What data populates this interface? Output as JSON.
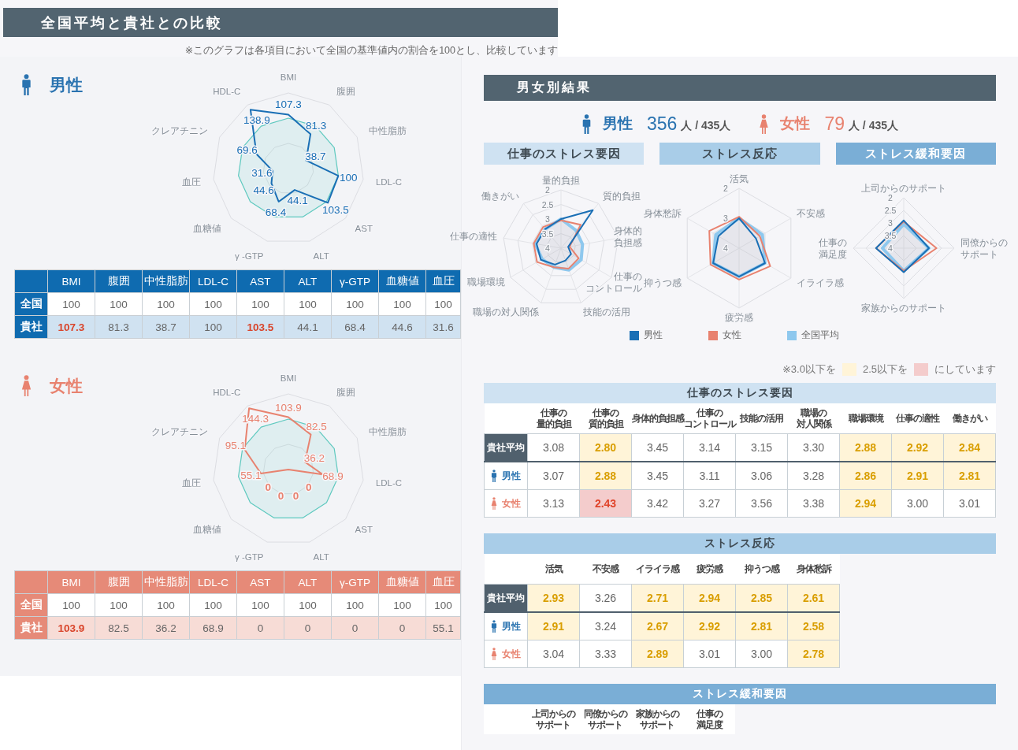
{
  "header": {
    "title": "全国平均と貴社との比較",
    "note": "※このグラフは各項目において全国の基準値内の割合を100とし、比較しています"
  },
  "comparison": [
    {
      "kind": "male",
      "title": "男性",
      "radar": {
        "axes": [
          [
            "BMI"
          ],
          [
            "HDL-C"
          ],
          [
            "腹囲"
          ],
          [
            "クレアチニン"
          ],
          [
            "中性脂肪"
          ],
          [
            "血圧"
          ],
          [
            "LDL-C"
          ],
          [
            "血糖値"
          ],
          [
            "AST"
          ],
          [
            "γ -GTP"
          ],
          [
            "ALT"
          ]
        ],
        "value_labels": [
          "107.3",
          "138.9",
          "81.3",
          "69.6",
          "38.7",
          "31.6",
          "100",
          "44.6",
          "44.1",
          "103.5",
          "68.4"
        ]
      },
      "table": {
        "columns": [
          "BMI",
          "腹囲",
          "中性脂肪",
          "LDL-C",
          "AST",
          "ALT",
          "γ-GTP",
          "血糖値",
          "血圧"
        ],
        "rows": [
          {
            "label": "全国",
            "kind": "national",
            "values": [
              {
                "text": "100",
                "high": false
              },
              {
                "text": "100",
                "high": false
              },
              {
                "text": "100",
                "high": false
              },
              {
                "text": "100",
                "high": false
              },
              {
                "text": "100",
                "high": false
              },
              {
                "text": "100",
                "high": false
              },
              {
                "text": "100",
                "high": false
              },
              {
                "text": "100",
                "high": false
              },
              {
                "text": "100",
                "high": false
              }
            ]
          },
          {
            "label": "貴社",
            "kind": "company",
            "values": [
              {
                "text": "107.3",
                "high": true
              },
              {
                "text": "81.3",
                "high": false
              },
              {
                "text": "38.7",
                "high": false
              },
              {
                "text": "100",
                "high": false
              },
              {
                "text": "103.5",
                "high": true
              },
              {
                "text": "44.1",
                "high": false
              },
              {
                "text": "68.4",
                "high": false
              },
              {
                "text": "44.6",
                "high": false
              },
              {
                "text": "31.6",
                "high": false
              }
            ]
          }
        ]
      }
    },
    {
      "kind": "female",
      "title": "女性",
      "radar": {
        "axes": [
          [
            "BMI"
          ],
          [
            "HDL-C"
          ],
          [
            "腹囲"
          ],
          [
            "クレアチニン"
          ],
          [
            "中性脂肪"
          ],
          [
            "血圧"
          ],
          [
            "LDL-C"
          ],
          [
            "血糖値"
          ],
          [
            "AST"
          ],
          [
            "γ -GTP"
          ],
          [
            "ALT"
          ]
        ],
        "value_labels": [
          "103.9",
          "144.3",
          "82.5",
          "95.1",
          "36.2",
          "55.1",
          "68.9",
          "0",
          "0",
          "0",
          "0"
        ]
      },
      "table": {
        "columns": [
          "BMI",
          "腹囲",
          "中性脂肪",
          "LDL-C",
          "AST",
          "ALT",
          "γ-GTP",
          "血糖値",
          "血圧"
        ],
        "rows": [
          {
            "label": "全国",
            "kind": "national",
            "values": [
              {
                "text": "100",
                "high": false
              },
              {
                "text": "100",
                "high": false
              },
              {
                "text": "100",
                "high": false
              },
              {
                "text": "100",
                "high": false
              },
              {
                "text": "100",
                "high": false
              },
              {
                "text": "100",
                "high": false
              },
              {
                "text": "100",
                "high": false
              },
              {
                "text": "100",
                "high": false
              },
              {
                "text": "100",
                "high": false
              }
            ]
          },
          {
            "label": "貴社",
            "kind": "company",
            "values": [
              {
                "text": "103.9",
                "high": true
              },
              {
                "text": "82.5",
                "high": false
              },
              {
                "text": "36.2",
                "high": false
              },
              {
                "text": "68.9",
                "high": false
              },
              {
                "text": "0",
                "high": false
              },
              {
                "text": "0",
                "high": false
              },
              {
                "text": "0",
                "high": false
              },
              {
                "text": "0",
                "high": false
              },
              {
                "text": "55.1",
                "high": false
              }
            ]
          }
        ]
      }
    }
  ],
  "results": {
    "title": "男女別結果",
    "counts": [
      {
        "kind": "male",
        "label": "男性",
        "count": "356",
        "total": "人 / 435人"
      },
      {
        "kind": "female",
        "label": "女性",
        "count": "79",
        "total": "人 / 435人"
      }
    ],
    "charts": [
      {
        "title": "仕事のストレス要因",
        "kind": "light",
        "radar": {
          "axes": [
            [
              "量的負担"
            ],
            [
              "働きがい"
            ],
            [
              "質的負担"
            ],
            [
              "仕事の適性"
            ],
            [
              "身体的",
              "負担感"
            ],
            [
              "職場環境"
            ],
            [
              "仕事の",
              "コントロール"
            ],
            [
              "職場の対人関係"
            ],
            [
              "技能の活用"
            ]
          ],
          "ticks": [
            "2",
            "2.5",
            "3",
            "3.5",
            "4"
          ]
        }
      },
      {
        "title": "ストレス反応",
        "kind": "mid",
        "radar": {
          "axes": [
            [
              "活気"
            ],
            [
              "身体愁訴"
            ],
            [
              "不安感"
            ],
            [
              "抑うつ感"
            ],
            [
              "イライラ感"
            ],
            [
              "疲労感"
            ]
          ],
          "ticks": [
            "2",
            "3",
            "4"
          ]
        }
      },
      {
        "title": "ストレス緩和要因",
        "kind": "dark",
        "radar": {
          "axes": [
            [
              "上司からのサポート"
            ],
            [
              "仕事の",
              "満足度"
            ],
            [
              "同僚からの",
              "サポート"
            ],
            [
              "家族からのサポート"
            ]
          ],
          "ticks": [
            "2",
            "2.5",
            "3",
            "3.5",
            "4"
          ]
        }
      }
    ],
    "legend": [
      {
        "name": "男性",
        "color": "#1a6fb5"
      },
      {
        "name": "女性",
        "color": "#e8826f"
      },
      {
        "name": "全国平均",
        "color": "#8ec8ee"
      }
    ],
    "highlight_note": [
      {
        "text": "※3.0以下を",
        "color": "#fff4d8"
      },
      {
        "text": "2.5以下を",
        "color": "#f4cccc"
      },
      {
        "text": "にしています"
      }
    ],
    "tables": [
      {
        "title": "仕事のストレス要因",
        "kind": "light",
        "columns": [
          [
            "仕事の",
            "量的負担"
          ],
          [
            "仕事の",
            "質的負担"
          ],
          [
            "身体的負担感"
          ],
          [
            "仕事の",
            "コントロール"
          ],
          [
            "技能の活用"
          ],
          [
            "職場の",
            "対人関係"
          ],
          [
            "職場環境"
          ],
          [
            "仕事の適性"
          ],
          [
            "働きがい"
          ]
        ],
        "rows": [
          {
            "label": "貴社平均",
            "kind": "average",
            "values": [
              {
                "text": "3.08"
              },
              {
                "text": "2.80",
                "color": "#fff4d8"
              },
              {
                "text": "3.45"
              },
              {
                "text": "3.14"
              },
              {
                "text": "3.15"
              },
              {
                "text": "3.30"
              },
              {
                "text": "2.88",
                "color": "#fff4d8"
              },
              {
                "text": "2.92",
                "color": "#fff4d8"
              },
              {
                "text": "2.84",
                "color": "#fff4d8"
              }
            ]
          },
          {
            "label": "男性",
            "kind": "male",
            "values": [
              {
                "text": "3.07"
              },
              {
                "text": "2.88",
                "color": "#fff4d8"
              },
              {
                "text": "3.45"
              },
              {
                "text": "3.11"
              },
              {
                "text": "3.06"
              },
              {
                "text": "3.28"
              },
              {
                "text": "2.86",
                "color": "#fff4d8"
              },
              {
                "text": "2.91",
                "color": "#fff4d8"
              },
              {
                "text": "2.81",
                "color": "#fff4d8"
              }
            ]
          },
          {
            "label": "女性",
            "kind": "female",
            "values": [
              {
                "text": "3.13"
              },
              {
                "text": "2.43",
                "color": "#f4cccc"
              },
              {
                "text": "3.42"
              },
              {
                "text": "3.27"
              },
              {
                "text": "3.56"
              },
              {
                "text": "3.38"
              },
              {
                "text": "2.94",
                "color": "#fff4d8"
              },
              {
                "text": "3.00"
              },
              {
                "text": "3.01"
              }
            ]
          }
        ]
      },
      {
        "title": "ストレス反応",
        "kind": "mid",
        "columns": [
          [
            "活気"
          ],
          [
            "不安感"
          ],
          [
            "イライラ感"
          ],
          [
            "疲労感"
          ],
          [
            "抑うつ感"
          ],
          [
            "身体愁訴"
          ]
        ],
        "rows": [
          {
            "label": "貴社平均",
            "kind": "average",
            "values": [
              {
                "text": "2.93",
                "color": "#fff4d8"
              },
              {
                "text": "3.26"
              },
              {
                "text": "2.71",
                "color": "#fff4d8"
              },
              {
                "text": "2.94",
                "color": "#fff4d8"
              },
              {
                "text": "2.85",
                "color": "#fff4d8"
              },
              {
                "text": "2.61",
                "color": "#fff4d8"
              }
            ]
          },
          {
            "label": "男性",
            "kind": "male",
            "values": [
              {
                "text": "2.91",
                "color": "#fff4d8"
              },
              {
                "text": "3.24"
              },
              {
                "text": "2.67",
                "color": "#fff4d8"
              },
              {
                "text": "2.92",
                "color": "#fff4d8"
              },
              {
                "text": "2.81",
                "color": "#fff4d8"
              },
              {
                "text": "2.58",
                "color": "#fff4d8"
              }
            ]
          },
          {
            "label": "女性",
            "kind": "female",
            "values": [
              {
                "text": "3.04"
              },
              {
                "text": "3.33"
              },
              {
                "text": "2.89",
                "color": "#fff4d8"
              },
              {
                "text": "3.01"
              },
              {
                "text": "3.00"
              },
              {
                "text": "2.78",
                "color": "#fff4d8"
              }
            ]
          }
        ]
      },
      {
        "title": "ストレス緩和要因",
        "kind": "dark",
        "columns": [
          [
            "上司からの",
            "サポート"
          ],
          [
            "同僚からの",
            "サポート"
          ],
          [
            "家族からの",
            "サポート"
          ],
          [
            "仕事の",
            "満足度"
          ]
        ]
      }
    ]
  }
}
